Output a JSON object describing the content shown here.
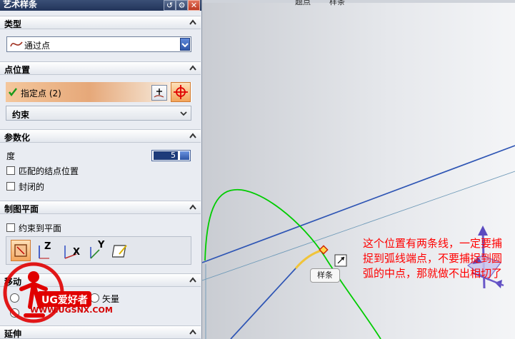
{
  "dialog": {
    "title": "艺术样条",
    "buttons": {
      "reset_icon": "reset-icon",
      "settings_icon": "gear-icon",
      "close_icon": "close-icon"
    }
  },
  "groups": {
    "type": {
      "label": "类型",
      "value": "通过点"
    },
    "point_position": {
      "label": "点位置",
      "specify_label": "指定点 (2)",
      "constraint_label": "约束"
    },
    "parameterization": {
      "label": "参数化",
      "degree_label": "度",
      "degree_value": "5",
      "match_knots_label": "匹配的结点位置",
      "closed_label": "封闭的"
    },
    "drawing_plane": {
      "label": "制图平面",
      "constrain_label": "约束到平面",
      "axes": [
        "Z",
        "X",
        "Y"
      ]
    },
    "move": {
      "label": "移动",
      "vector_label": "矢量"
    },
    "extend": {
      "label": "延伸"
    }
  },
  "viewport": {
    "top_labels": [
      "题点",
      "样条"
    ],
    "tooltip": "样条",
    "annotation": "这个位置有两条线，一定要捕捉到弧线端点，不要捕捉到圆弧的中点，那就做不出相切了"
  },
  "watermark": {
    "site": "WWW.UGSNX.COM",
    "brand": "UG爱好者"
  },
  "colors": {
    "annotation": "#ff0000",
    "curve_green": "#00cc00",
    "line_blue": "#2e55b4",
    "selection_orange": "#e8a878"
  }
}
